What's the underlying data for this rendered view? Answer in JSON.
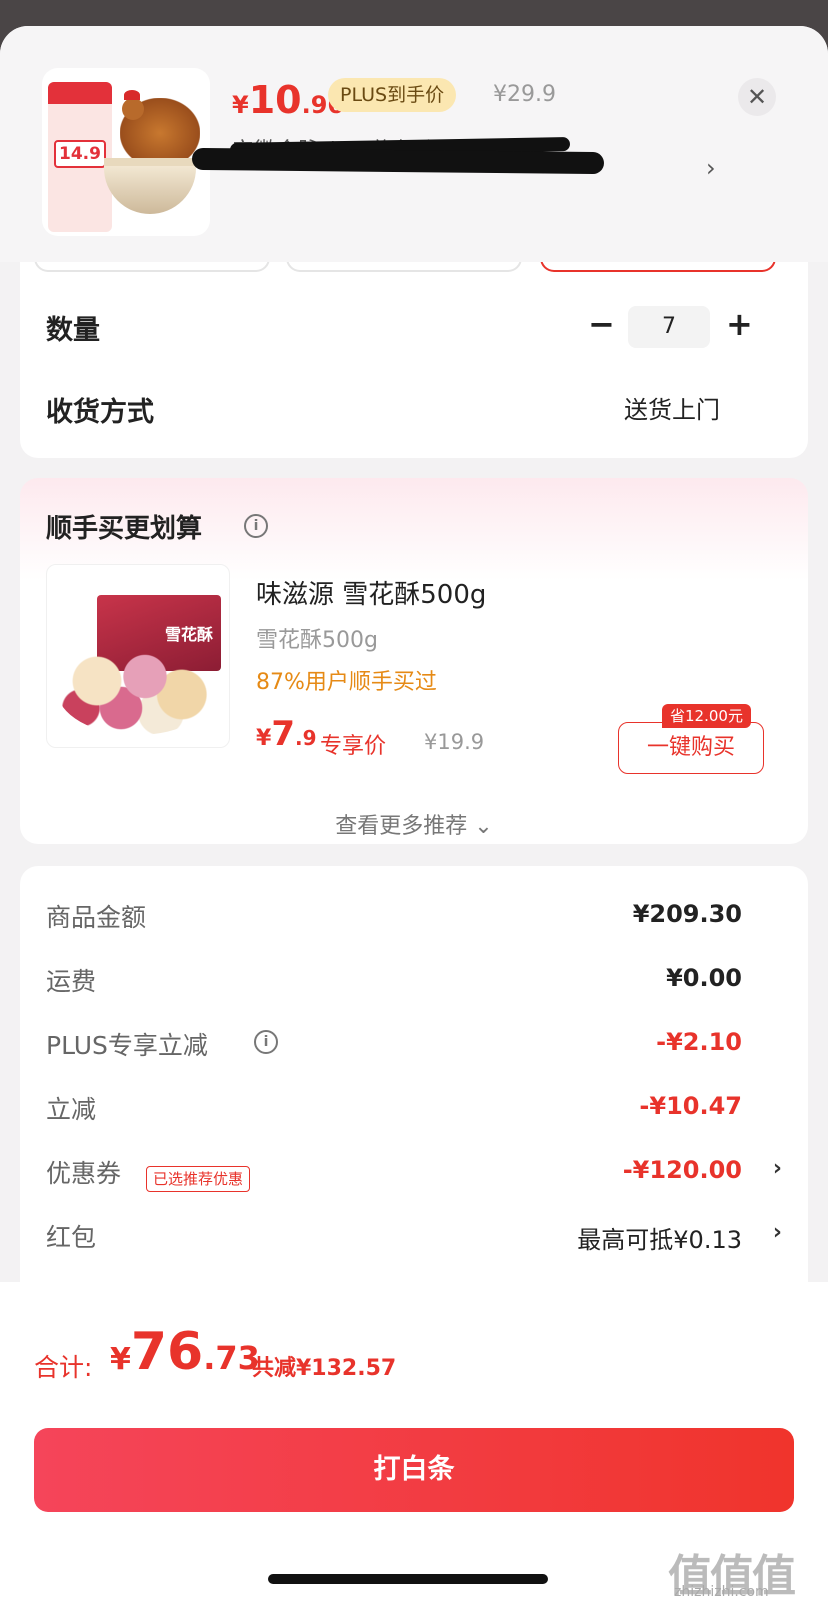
{
  "header": {
    "thumb_promo_price": "14.9",
    "price_yen": "¥",
    "price_int": "10",
    "price_dec": ".96",
    "plus_tag": "PLUS到手价",
    "original_price": "¥29.9",
    "close_glyph": "✕",
    "store_name": "安徽金脉 (**) 旗舰店",
    "store_arrow": "›"
  },
  "options": {
    "quantity_label": "数量",
    "minus": "−",
    "quantity": "7",
    "plus": "+",
    "delivery_label": "收货方式",
    "delivery_value": "送货上门"
  },
  "recommend": {
    "title": "顺手买更划算",
    "info_glyph": "i",
    "box_label": "雪花酥",
    "item_name": "味滋源 雪花酥500g",
    "item_spec": "雪花酥500g",
    "item_stat": "87%用户顺手买过",
    "price_yen": "¥",
    "price_int": "7",
    "price_dec": ".9",
    "exclusive": "专享价",
    "original_price": "¥19.9",
    "save_tag": "省12.00元",
    "buy_button": "一键购买",
    "more": "查看更多推荐 ⌄"
  },
  "summary": {
    "rows": [
      {
        "label": "商品金额",
        "value": "¥209.30"
      },
      {
        "label": "运费",
        "value": "¥0.00"
      },
      {
        "label": "PLUS专享立减",
        "value": "-¥2.10"
      },
      {
        "label": "立减",
        "value": "-¥10.47"
      },
      {
        "label": "优惠券",
        "value": "-¥120.00"
      },
      {
        "label": "红包",
        "value": "最高可抵¥0.13"
      }
    ],
    "info_glyph": "i",
    "coupon_tag": "已选推荐优惠",
    "chevron": "›"
  },
  "footer": {
    "total_label": "合计:",
    "total_yen": "¥",
    "total_int": "76",
    "total_dec": ".73",
    "total_save": "共减¥132.57",
    "pay_button": "打白条"
  },
  "watermark": {
    "glyphs": "值值值",
    "url": "zhizhizhi.com"
  },
  "colors": {
    "accent": "#e8332b",
    "plus_tag_bg": "#fbe7b1",
    "stat_orange": "#e68a15"
  }
}
